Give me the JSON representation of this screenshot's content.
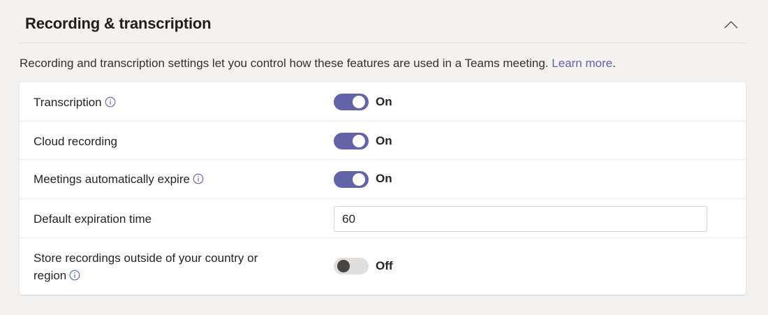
{
  "section": {
    "title": "Recording & transcription",
    "description_text": "Recording and transcription settings let you control how these features are used in a Teams meeting. ",
    "learn_more_label": "Learn more",
    "description_end": "."
  },
  "settings": [
    {
      "label": "Transcription",
      "type": "toggle",
      "state": "On",
      "has_info": true
    },
    {
      "label": "Cloud recording",
      "type": "toggle",
      "state": "On",
      "has_info": false
    },
    {
      "label": "Meetings automatically expire",
      "type": "toggle",
      "state": "On",
      "has_info": true
    },
    {
      "label": "Default expiration time",
      "type": "input",
      "value": "60",
      "has_info": false
    },
    {
      "label_line1": "Store recordings outside of your country or",
      "label_line2": "region",
      "type": "toggle",
      "state": "Off",
      "has_info": true
    }
  ],
  "colors": {
    "accent": "#6264a7",
    "toggle_off": "#e1dfdd",
    "background": "#f3f2f1"
  }
}
